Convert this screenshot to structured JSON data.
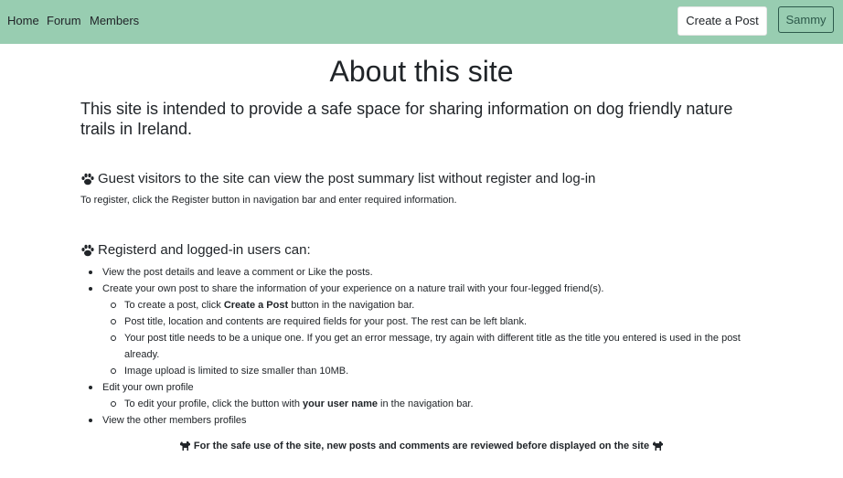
{
  "nav": {
    "home": "Home",
    "forum": "Forum",
    "members": "Members",
    "create_post": "Create a Post",
    "user": "Sammy"
  },
  "page": {
    "title": "About this site",
    "intro": "This site is intended to provide a safe space for sharing information on dog friendly nature trails in Ireland."
  },
  "guest": {
    "heading": "Guest visitors to the site can view the post summary list without register and log-in",
    "text": "To register, click the Register button in navigation bar and enter required information."
  },
  "users": {
    "heading": "Registerd and logged-in users can:",
    "item1": "View the post details and leave a comment or Like the posts.",
    "item2": "Create your own post to share the information of your experience on a nature trail with your four-legged friend(s).",
    "sub1_pre": "To create a post, click ",
    "sub1_bold": "Create a Post",
    "sub1_post": " button in the navigation bar.",
    "sub2": "Post title, location and contents are required fields for your post. The rest can be left blank.",
    "sub3": "Your post title needs to be a unique one. If you get an error message, try again with different title as the title you entered is used in the post already.",
    "sub4": "Image upload is limited to size smaller than 10MB.",
    "item3": "Edit your own profile",
    "sub5_pre": "To edit your profile, click the button with ",
    "sub5_bold": "your user name",
    "sub5_post": " in the navigation bar.",
    "item4": "View the other members profiles"
  },
  "footer": {
    "note": "For the safe use of the site, new posts and comments are reviewed before displayed on the site"
  },
  "icons": {
    "section": "paw-icon",
    "footer": "dog-icon"
  },
  "colors": {
    "navbar": "#98cdb1",
    "user_button_border": "#2d5a4b"
  }
}
